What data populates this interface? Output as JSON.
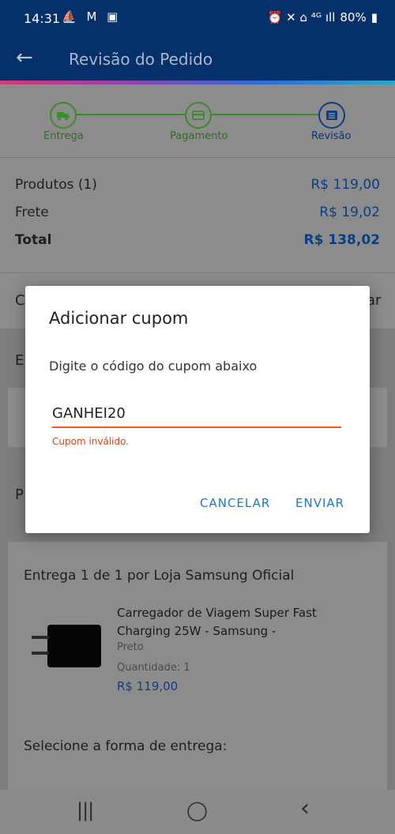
{
  "status_bar": {
    "time": "14:31",
    "left_icons": "⛵ M ▣",
    "right_icons": "⏰ ✕ ⌂ ⁴ᴳ ıll",
    "battery": "80%"
  },
  "app_bar": {
    "back_icon": "←",
    "title": "Revisão do Pedido"
  },
  "stepper": {
    "steps": [
      {
        "label": "Entrega",
        "icon": "truck-icon",
        "state": "done"
      },
      {
        "label": "Pagamento",
        "icon": "card-icon",
        "state": "done"
      },
      {
        "label": "Revisão",
        "icon": "list-icon",
        "state": "current"
      }
    ]
  },
  "summary": {
    "products_label": "Produtos (1)",
    "products_value": "R$ 119,00",
    "shipping_label": "Frete",
    "shipping_value": "R$ 19,02",
    "total_label": "Total",
    "total_value": "R$ 138,02"
  },
  "behind": {
    "c_left": "C",
    "c_right": "ar",
    "e_left": "E",
    "p_left": "P"
  },
  "delivery": {
    "heading": "Entrega 1 de 1 por Loja Samsung Oficial",
    "product_name": "Carregador de Viagem Super Fast Charging 25W - Samsung -",
    "product_color": "Preto",
    "quantity": "Quantidade: 1",
    "price": "R$ 119,00",
    "shipping_select_label": "Selecione a forma de entrega:"
  },
  "dialog": {
    "title": "Adicionar cupom",
    "message": "Digite o código do cupom abaixo",
    "input_value": "GANHEI20",
    "error": "Cupom inválido.",
    "cancel_label": "CANCELAR",
    "submit_label": "ENVIAR"
  },
  "nav_bar": {
    "recents": "|||",
    "home": "◯",
    "back": "‹"
  },
  "colors": {
    "app_bar": "#06306a",
    "accent_blue": "#1c78c8",
    "error": "#d4431b",
    "step_green": "#3c8a2b"
  }
}
